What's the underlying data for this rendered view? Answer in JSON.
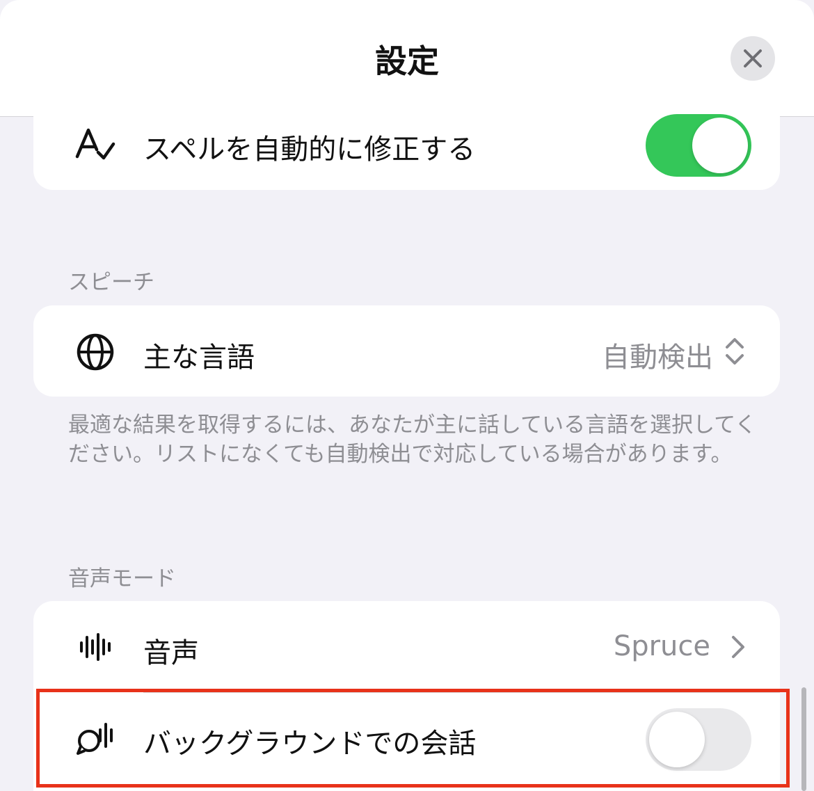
{
  "header": {
    "title": "設定",
    "close_icon": "close-icon"
  },
  "autocorrect": {
    "label": "スペルを自動的に修正する",
    "icon": "text-check-icon",
    "enabled": true
  },
  "speech": {
    "section_title": "スピーチ",
    "language_label": "主な言語",
    "language_value": "自動検出",
    "language_icon": "globe-icon",
    "footnote": "最適な結果を取得するには、あなたが主に話している言語を選択してください。リストになくても自動検出で対応している場合があります。"
  },
  "voice_mode": {
    "section_title": "音声モード",
    "voice_label": "音声",
    "voice_value": "Spruce",
    "voice_icon": "waveform-icon",
    "background_label": "バックグラウンドでの会話",
    "background_icon": "background-conversation-icon",
    "background_enabled": false
  },
  "colors": {
    "toggle_on": "#34c759",
    "highlight": "#e8321a",
    "secondary_text": "#8e8e93"
  }
}
